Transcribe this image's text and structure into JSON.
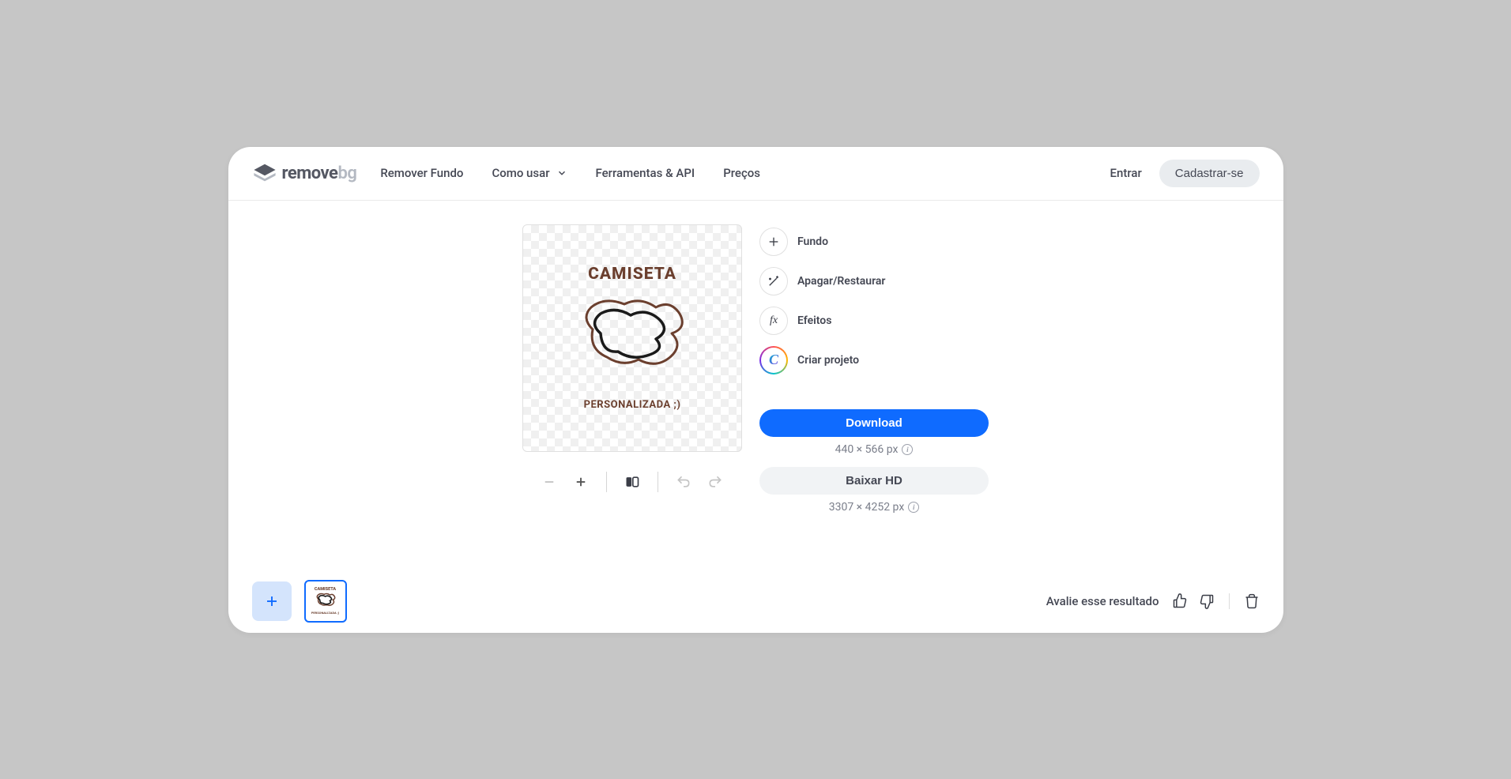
{
  "logo": {
    "text_main": "remove",
    "text_suffix": "bg"
  },
  "nav": {
    "remove_bg": "Remover Fundo",
    "how_to": "Como usar",
    "tools_api": "Ferramentas & API",
    "pricing": "Preços"
  },
  "auth": {
    "login": "Entrar",
    "signup": "Cadastrar-se"
  },
  "preview": {
    "title": "CAMISETA",
    "subtitle": "PERSONALIZADA ;)"
  },
  "actions": {
    "background": "Fundo",
    "erase_restore": "Apagar/Restaurar",
    "effects": "Efeitos",
    "create_project": "Criar projeto"
  },
  "download": {
    "primary_label": "Download",
    "primary_resolution": "440 × 566 px",
    "secondary_label": "Baixar HD",
    "secondary_resolution": "3307 × 4252 px"
  },
  "rating": {
    "label": "Avalie esse resultado"
  }
}
